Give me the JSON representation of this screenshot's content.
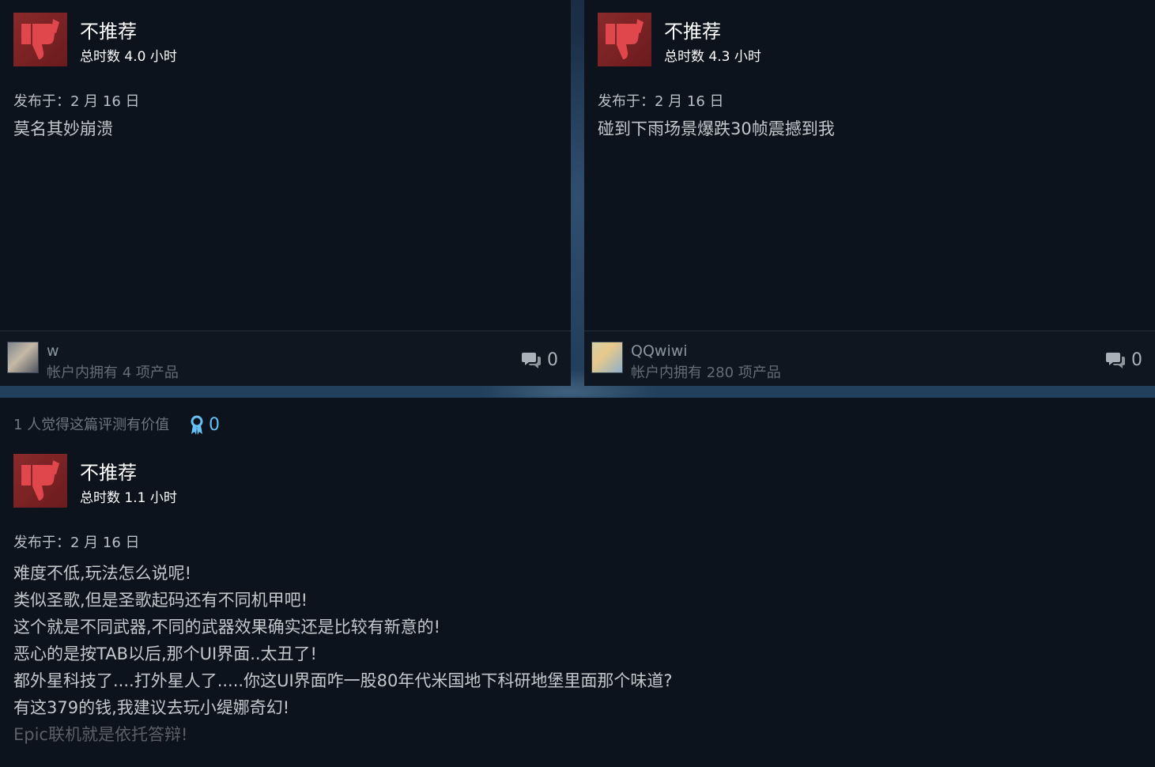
{
  "reviews": [
    {
      "verdict": "不推荐",
      "hours": "总时数 4.0 小时",
      "posted": "发布于：2 月 16 日",
      "body": "莫名其妙崩溃",
      "user": {
        "name": "w",
        "products": "帐户内拥有 4 项产品"
      },
      "comments": "0"
    },
    {
      "verdict": "不推荐",
      "hours": "总时数 4.3 小时",
      "posted": "发布于：2 月 16 日",
      "body": "碰到下雨场景爆跌30帧震撼到我",
      "user": {
        "name": "QQwiwi",
        "products": "帐户内拥有 280 项产品"
      },
      "comments": "0"
    },
    {
      "helpful": "1 人觉得这篇评测有价值",
      "awards": "0",
      "verdict": "不推荐",
      "hours": "总时数 1.1 小时",
      "posted": "发布于：2 月 16 日",
      "body_lines": [
        "难度不低,玩法怎么说呢!",
        "类似圣歌,但是圣歌起码还有不同机甲吧!",
        "这个就是不同武器,不同的武器效果确实还是比较有新意的!",
        "恶心的是按TAB以后,那个UI界面..太丑了!",
        "都外星科技了....打外星人了.....你这UI界面咋一股80年代米国地下科研地堡里面那个味道?",
        "有这379的钱,我建议去玩小缇娜奇幻!",
        "Epic联机就是依托答辩!"
      ]
    }
  ],
  "icons": {
    "thumb": "thumbs-down-icon",
    "comment": "comment-bubbles-icon",
    "award": "award-ribbon-icon"
  },
  "colors": {
    "thumb_bg": "#7a2224",
    "thumb_fg": "#e0474c",
    "award": "#66c0f4"
  }
}
